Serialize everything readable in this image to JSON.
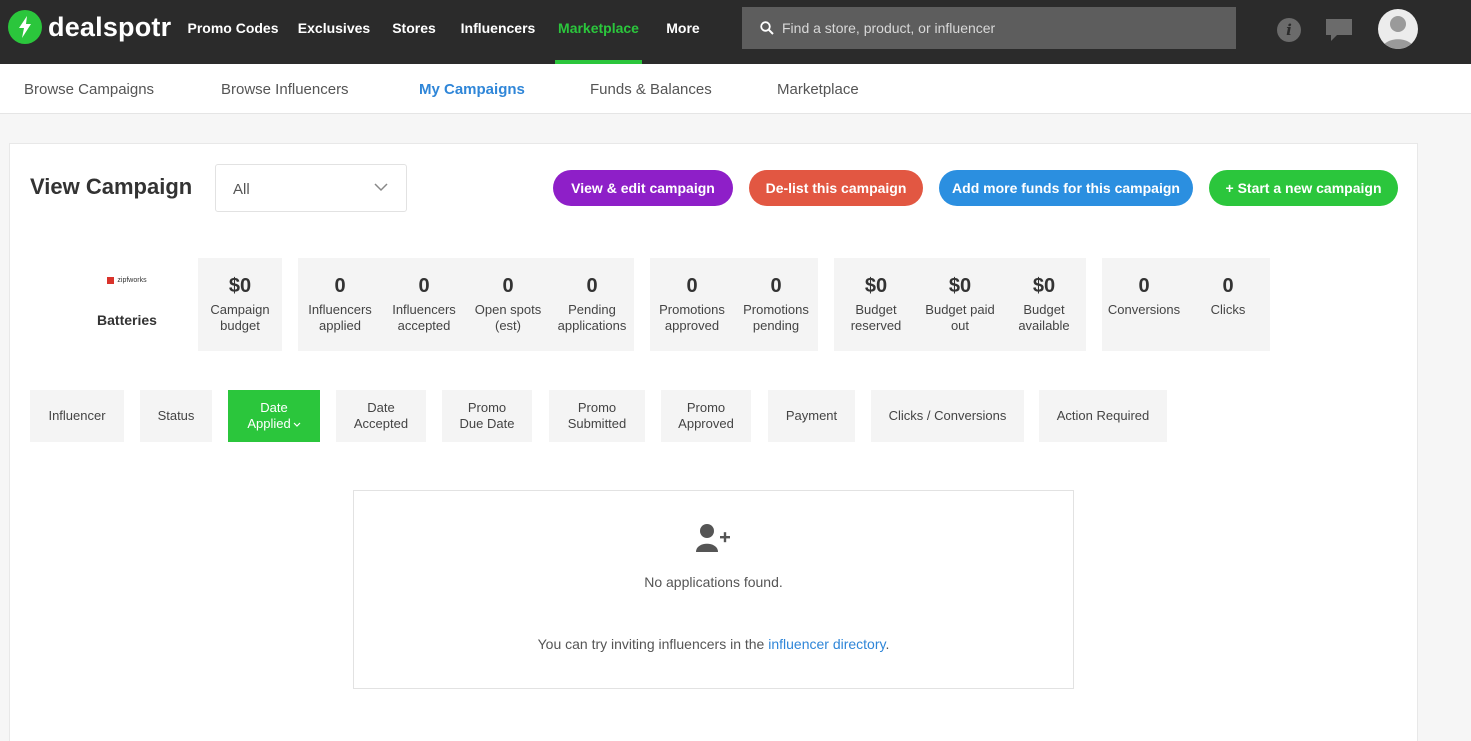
{
  "brand": {
    "name": "dealspotr",
    "accent": "#2bc63c"
  },
  "topnav": {
    "items": [
      "Promo Codes",
      "Exclusives",
      "Stores",
      "Influencers",
      "Marketplace",
      "More"
    ],
    "active": "Marketplace"
  },
  "search": {
    "placeholder": "Find a store, product, or influencer"
  },
  "subnav": {
    "items": [
      "Browse Campaigns",
      "Browse Influencers",
      "My Campaigns",
      "Funds & Balances",
      "Marketplace"
    ],
    "active": "My Campaigns"
  },
  "page": {
    "title": "View Campaign",
    "filter_value": "All"
  },
  "actions": {
    "edit": "View & edit campaign",
    "delist": "De-list this campaign",
    "add_funds": "Add more funds for this campaign",
    "new": "+ Start a new campaign"
  },
  "campaign": {
    "logo_text": "zipfworks",
    "name": "Batteries"
  },
  "stats": [
    {
      "value": "$0",
      "label": "Campaign budget"
    },
    {
      "value": "0",
      "label": "Influencers applied"
    },
    {
      "value": "0",
      "label": "Influencers accepted"
    },
    {
      "value": "0",
      "label": "Open spots (est)"
    },
    {
      "value": "0",
      "label": "Pending applications"
    },
    {
      "value": "0",
      "label": "Promotions approved"
    },
    {
      "value": "0",
      "label": "Promotions pending"
    },
    {
      "value": "$0",
      "label": "Budget reserved"
    },
    {
      "value": "$0",
      "label": "Budget paid out"
    },
    {
      "value": "$0",
      "label": "Budget available"
    },
    {
      "value": "0",
      "label": "Conversions"
    },
    {
      "value": "0",
      "label": "Clicks"
    }
  ],
  "columns": [
    "Influencer",
    "Status",
    "Date Applied",
    "Date Accepted",
    "Promo Due Date",
    "Promo Submitted",
    "Promo Approved",
    "Payment",
    "Clicks / Conversions",
    "Action Required"
  ],
  "active_column": "Date Applied",
  "empty": {
    "message": "No applications found.",
    "hint_prefix": "You can try inviting influencers in the ",
    "hint_link": "influencer directory",
    "hint_suffix": "."
  }
}
